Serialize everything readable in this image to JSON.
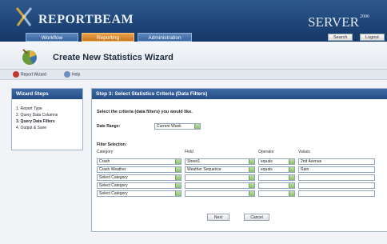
{
  "app": {
    "brand": "REPORTBEAM",
    "server": "SERVER",
    "server_year": "2006"
  },
  "nav": {
    "tabs": [
      "Workflow",
      "Reporting",
      "Administration"
    ],
    "active": "Reporting"
  },
  "header_buttons": {
    "search": "Search",
    "logout": "Logout"
  },
  "page_title": "Create New Statistics Wizard",
  "toolbar": {
    "report_wizard": "Report Wizard",
    "help": "Help"
  },
  "wizard_steps": {
    "title": "Wizard Steps",
    "items": [
      "1. Report Type",
      "2. Query Data Columns",
      "3. Query Data Filters",
      "4. Output & Save"
    ],
    "current_index": 2
  },
  "main": {
    "title": "Step 3: Select Statistics Criteria (Data Filters)",
    "instruction": "Select the criteria (data filters) you would like.",
    "date_range_label": "Date Range:",
    "date_range_value": "Current Week",
    "filter_label": "Filter Selection:",
    "columns": {
      "category": "Category",
      "field": "Field",
      "operator": "Operator",
      "values": "Values"
    },
    "rows": [
      {
        "category": "Crash",
        "field": "Street1",
        "operator": "equals",
        "value": "2nd Avenue"
      },
      {
        "category": "Crash Weather",
        "field": "Weather Sequence",
        "operator": "equals",
        "value": "Rain"
      },
      {
        "category": "Select Category",
        "field": "",
        "operator": "",
        "value": ""
      },
      {
        "category": "Select Category",
        "field": "",
        "operator": "",
        "value": ""
      },
      {
        "category": "Select Category",
        "field": "",
        "operator": "",
        "value": ""
      }
    ],
    "buttons": {
      "next": "Next",
      "cancel": "Cancel"
    }
  },
  "colors": {
    "header": "#1f4578",
    "active_tab": "#c97622",
    "panel_head": "#2f5a92",
    "dropdown_arrow": "#8cc06a"
  }
}
